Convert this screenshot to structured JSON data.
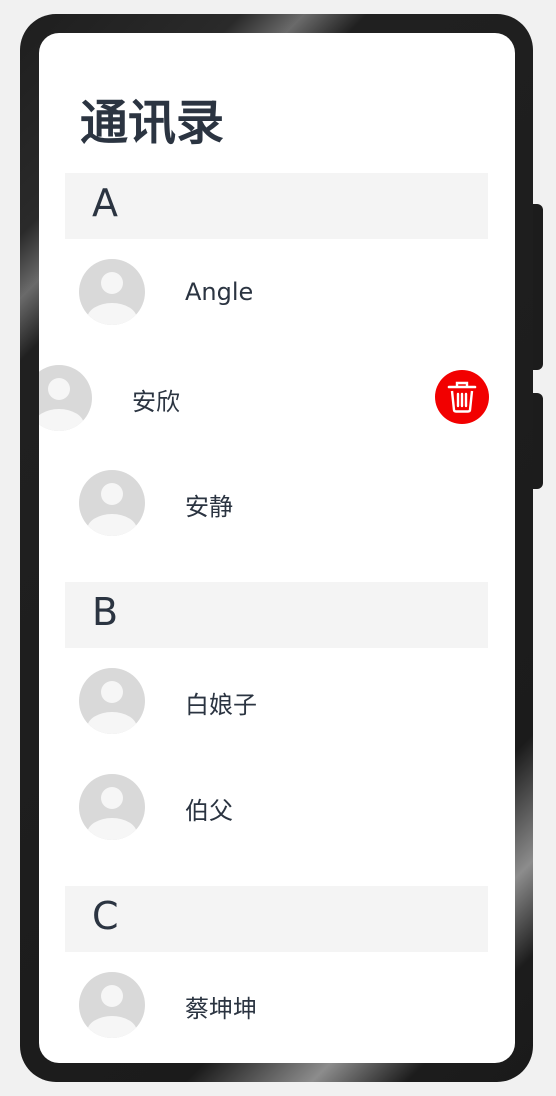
{
  "page": {
    "title": "通讯录"
  },
  "sections": [
    {
      "letter": "A",
      "contacts": [
        {
          "name": "Angle"
        },
        {
          "name": "安欣"
        },
        {
          "name": "安静"
        }
      ]
    },
    {
      "letter": "B",
      "contacts": [
        {
          "name": "白娘子"
        },
        {
          "name": "伯父"
        }
      ]
    },
    {
      "letter": "C",
      "contacts": [
        {
          "name": "蔡坤坤"
        }
      ]
    }
  ],
  "icons": {
    "avatar": "person-avatar-icon",
    "delete": "trash-icon"
  },
  "colors": {
    "delete": "#f20000",
    "text": "#2b3441",
    "header_bg": "#f4f4f4",
    "avatar": "#d9d9d9"
  }
}
